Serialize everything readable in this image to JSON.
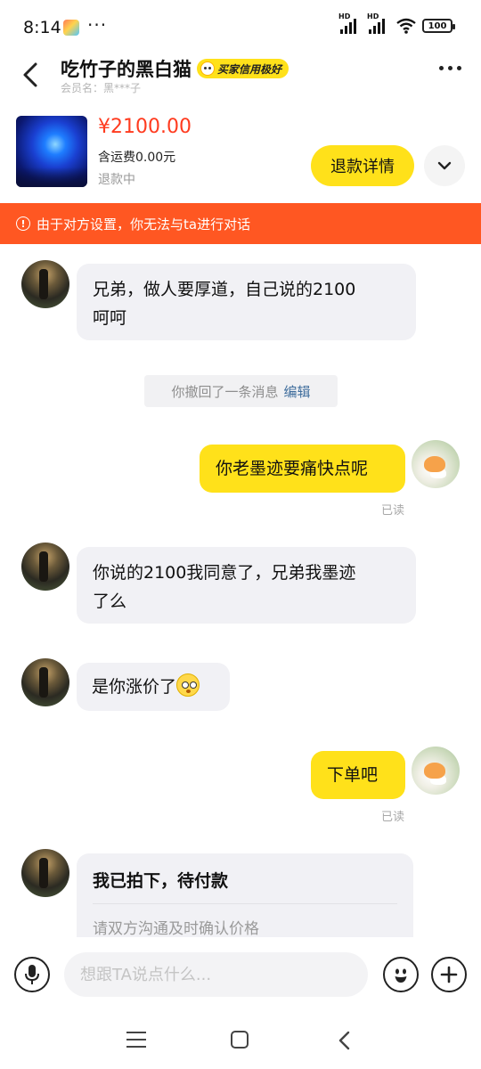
{
  "status_bar": {
    "time": "8:14",
    "dots": "···",
    "battery": "100",
    "signal_label": "HD"
  },
  "header": {
    "title": "吃竹子的黑白猫",
    "credit_badge": "买家信用极好",
    "member_label": "会员名：黑***子"
  },
  "product": {
    "price": "¥2100.00",
    "shipping": "含运费0.00元",
    "status": "退款中",
    "refund_button": "退款详情"
  },
  "warning": {
    "icon": "!",
    "text": "由于对方设置，你无法与ta进行对话"
  },
  "messages": {
    "m1": {
      "line1": "兄弟，做人要厚道，自己说的2100",
      "line2": "呵呵"
    },
    "recall": {
      "text": "你撤回了一条消息",
      "action": "编辑"
    },
    "m2": {
      "text": "你老墨迹要痛快点呢",
      "read": "已读"
    },
    "m3": {
      "line1": "你说的2100我同意了，兄弟我墨迹",
      "line2": "了么"
    },
    "m4": {
      "text": "是你涨价了"
    },
    "m5": {
      "text": "下单吧",
      "read": "已读"
    },
    "order_card": {
      "title": "我已拍下，待付款",
      "subtitle": "请双方沟通及时确认价格"
    }
  },
  "input": {
    "placeholder": "想跟TA说点什么..."
  },
  "icons": {
    "back": "back-arrow-icon",
    "more": "more-icon",
    "expand": "chevron-down-icon",
    "voice": "microphone-icon",
    "emoji": "emoji-icon",
    "add": "plus-icon"
  },
  "colors": {
    "accent": "#ffe11a",
    "warning": "#ff5722",
    "price": "#ff3b1f"
  }
}
